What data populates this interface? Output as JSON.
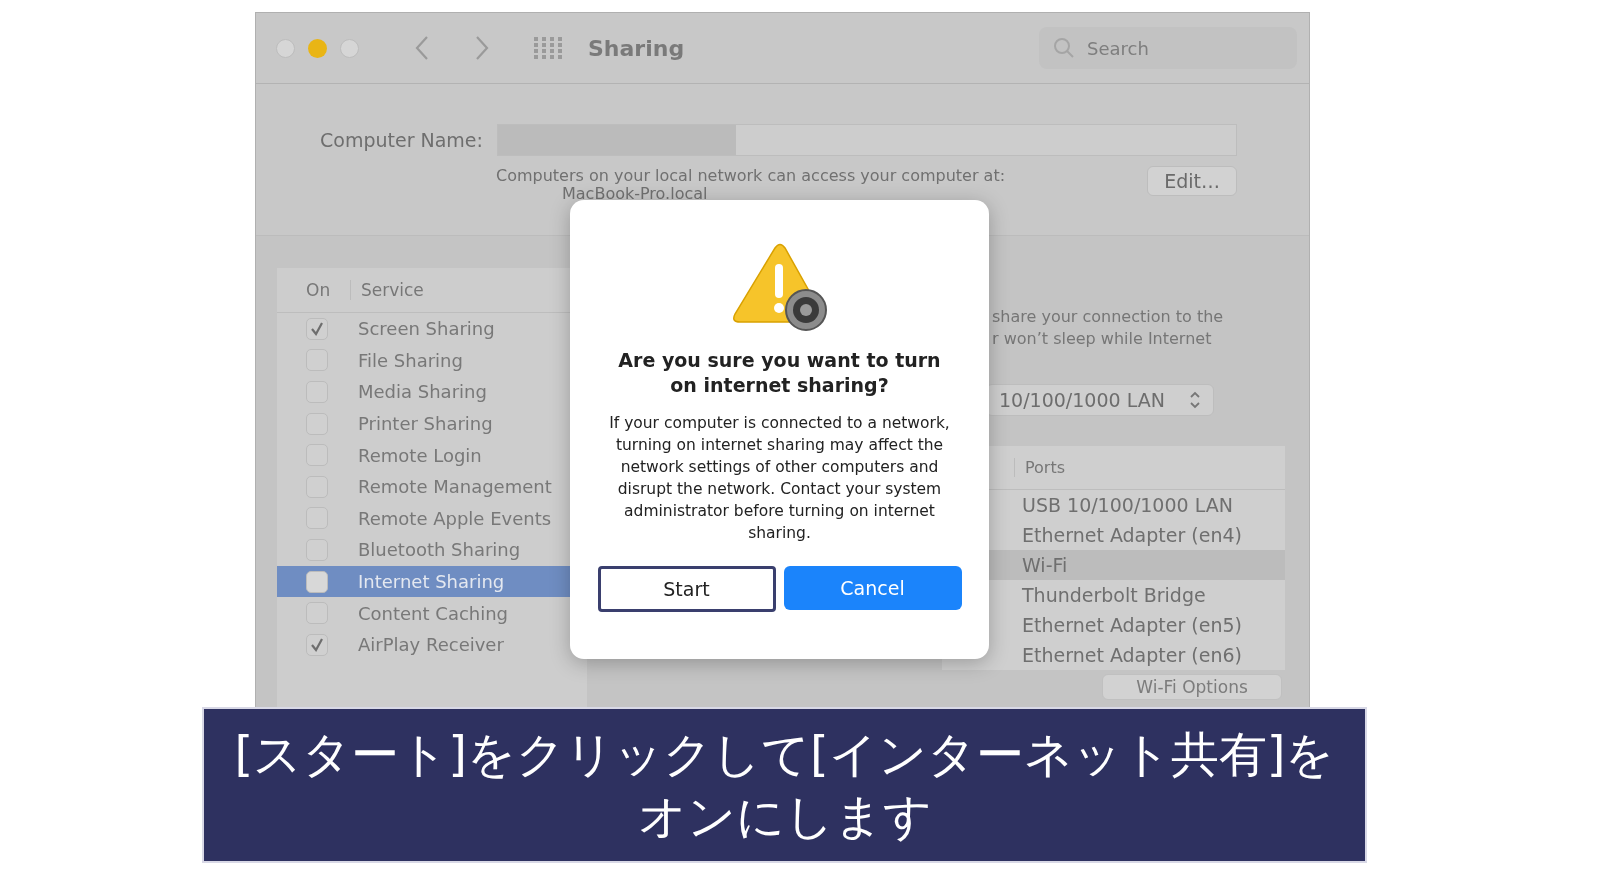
{
  "window": {
    "title": "Sharing",
    "search": {
      "placeholder": "Search"
    }
  },
  "computer_name": {
    "label": "Computer Name:",
    "note": "Computers on your local network can access your computer at:",
    "address": "MacBook-Pro.local",
    "edit_button": "Edit…"
  },
  "services": {
    "columns": [
      "On",
      "Service"
    ],
    "rows": [
      {
        "name": "Screen Sharing",
        "checked": true,
        "selected": false
      },
      {
        "name": "File Sharing",
        "checked": false,
        "selected": false
      },
      {
        "name": "Media Sharing",
        "checked": false,
        "selected": false
      },
      {
        "name": "Printer Sharing",
        "checked": false,
        "selected": false
      },
      {
        "name": "Remote Login",
        "checked": false,
        "selected": false
      },
      {
        "name": "Remote Management",
        "checked": false,
        "selected": false
      },
      {
        "name": "Remote Apple Events",
        "checked": false,
        "selected": false
      },
      {
        "name": "Bluetooth Sharing",
        "checked": false,
        "selected": false
      },
      {
        "name": "Internet Sharing",
        "checked": false,
        "selected": true
      },
      {
        "name": "Content Caching",
        "checked": false,
        "selected": false
      },
      {
        "name": "AirPlay Receiver",
        "checked": true,
        "selected": false
      }
    ]
  },
  "internet_sharing": {
    "description_lines": [
      "share your connection to the",
      "r won’t sleep while Internet"
    ],
    "share_from": "10/100/1000 LAN",
    "ports_column": "Ports",
    "ports": [
      {
        "name": "USB 10/100/1000 LAN",
        "selected": false
      },
      {
        "name": "Ethernet Adapter (en4)",
        "selected": false
      },
      {
        "name": "Wi-Fi",
        "selected": true
      },
      {
        "name": "Thunderbolt Bridge",
        "selected": false
      },
      {
        "name": "Ethernet Adapter (en5)",
        "selected": false
      },
      {
        "name": "Ethernet Adapter (en6)",
        "selected": false
      }
    ],
    "wifi_options_button": "Wi-Fi Options"
  },
  "dialog": {
    "title": "Are you sure you want to turn on internet sharing?",
    "message": "If your computer is connected to a network, turning on internet sharing may affect the network settings of other computers and disrupt the network. Contact your system administrator before turning on internet sharing.",
    "buttons": [
      {
        "label": "Start",
        "kind": "focused"
      },
      {
        "label": "Cancel",
        "kind": "primary"
      }
    ]
  },
  "caption": "[スタート]をクリックして[インターネット共有]をオンにします"
}
